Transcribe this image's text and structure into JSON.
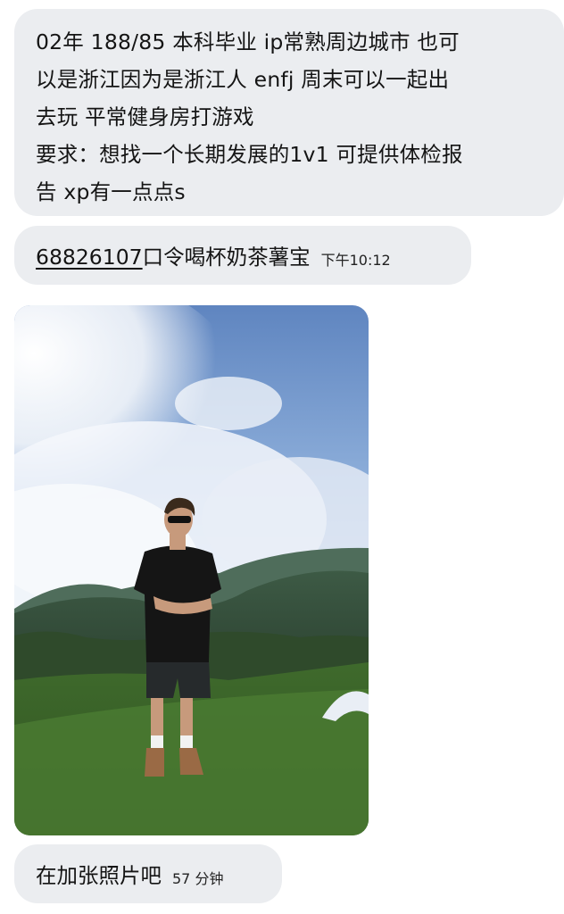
{
  "messages": {
    "intro": {
      "lines": [
        "02年 188/85 本科毕业 ip常熟周边城市 也可",
        "以是浙江因为是浙江人 enfj 周末可以一起出",
        "去玩 平常健身房打游戏",
        "要求：想找一个长期发展的1v1 可提供体检报",
        "告 xp有一点点s"
      ]
    },
    "code": {
      "number": "68826107",
      "text": "口令喝杯奶茶薯宝",
      "time": "下午10:12"
    },
    "photo": {
      "kind": "photo of a man in sunglasses and black t-shirt standing on a grassy hill under a cloudy sky"
    },
    "last": {
      "text": "在加张照片吧",
      "time": "57 分钟"
    }
  },
  "colors": {
    "bubble": "#ebedf0",
    "text": "#141414",
    "background": "#ffffff"
  }
}
